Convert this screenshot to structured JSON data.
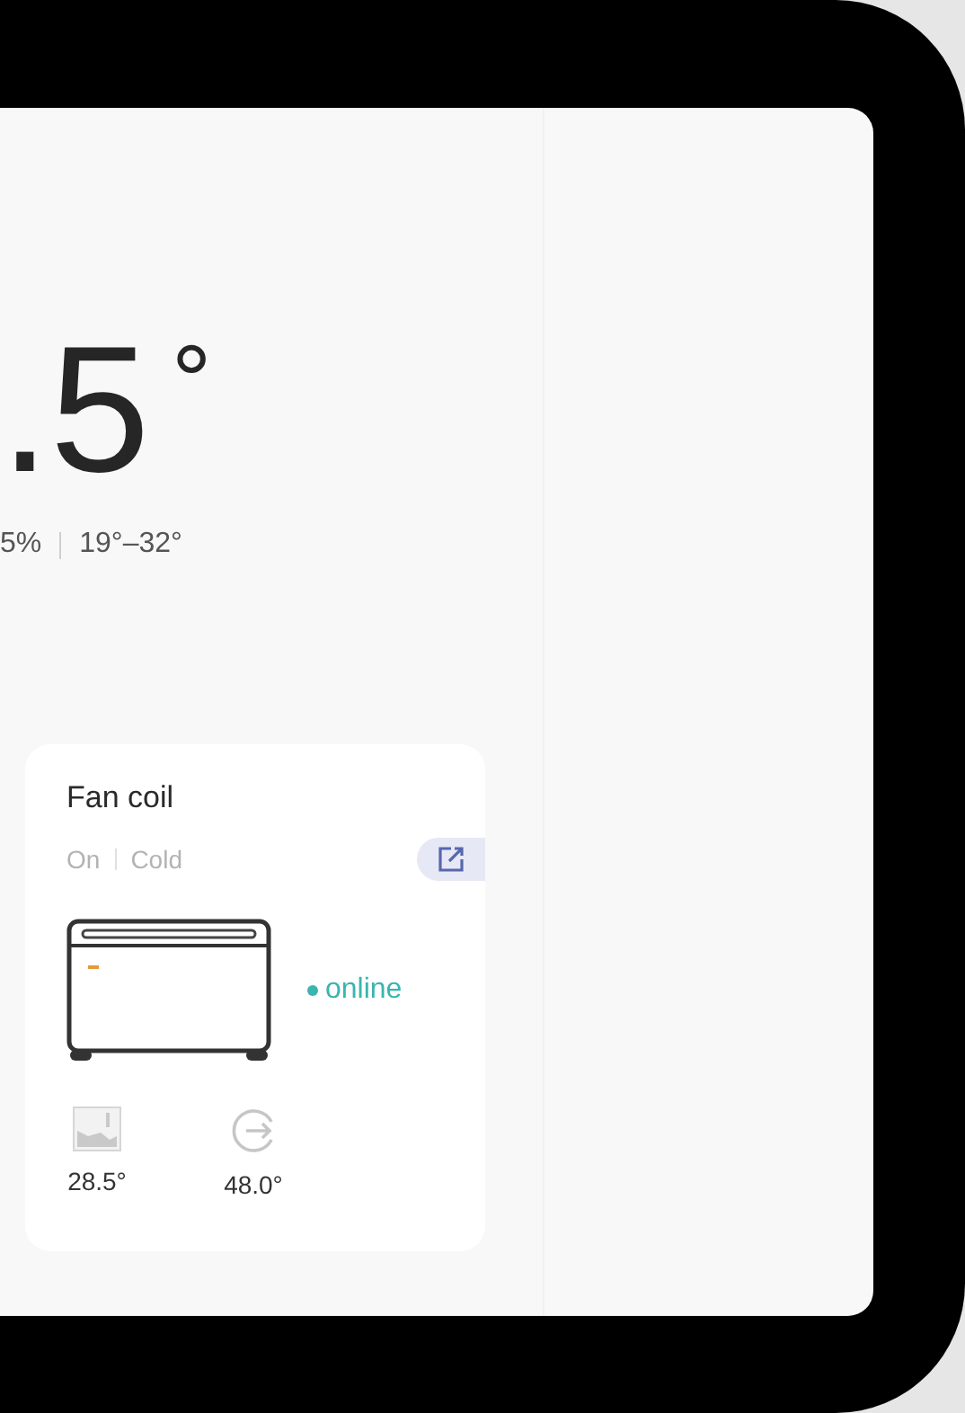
{
  "weather": {
    "temperature": ".5",
    "unit": "°",
    "humidity": "5%",
    "range": "19°–32°"
  },
  "device_card": {
    "name": "Fan coil",
    "power": "On",
    "mode": "Cold",
    "status": {
      "label": "online",
      "online": true
    },
    "readings": [
      {
        "kind": "room",
        "value": "28.5°"
      },
      {
        "kind": "outlet",
        "value": "48.0°"
      }
    ]
  }
}
